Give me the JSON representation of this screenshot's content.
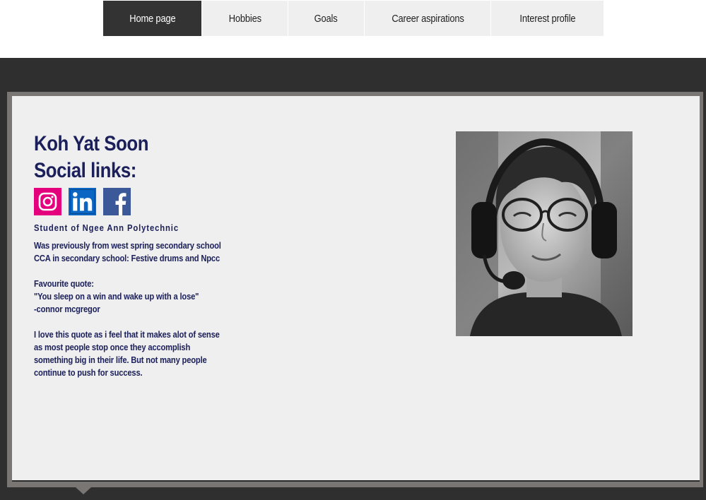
{
  "nav": {
    "items": [
      {
        "label": "Home page",
        "active": true
      },
      {
        "label": "Hobbies",
        "active": false
      },
      {
        "label": "Goals",
        "active": false
      },
      {
        "label": "Career aspirations",
        "active": false
      },
      {
        "label": "Interest profile",
        "active": false
      }
    ]
  },
  "profile": {
    "name": "Koh Yat Soon",
    "social_title": "Social links:",
    "social_icons": [
      "instagram-icon",
      "linkedin-icon",
      "facebook-icon"
    ],
    "school": "Student of Ngee Ann Polytechnic",
    "bio_lines": [
      "Was previously from west spring secondary school",
      "CCA in secondary school:  Festive drums and Npcc"
    ],
    "quote_lines": [
      "Favourite quote:",
      "\"You sleep on a win and wake up with a lose\"",
      "-connor mcgregor"
    ],
    "reflection_lines": [
      "I love this quote as i feel that it makes alot of sense",
      "as most people stop once they accomplish",
      "something big in their life.  But not many people",
      "continue to push for success."
    ]
  },
  "colors": {
    "heading": "#1b1f5a",
    "nav_active": "#333333",
    "nav_inactive": "#efefef",
    "band": "#2f2f2f",
    "panel": "#efefef",
    "instagram": "#e4007c",
    "linkedin": "#0a66c2",
    "facebook": "#3b5998"
  }
}
